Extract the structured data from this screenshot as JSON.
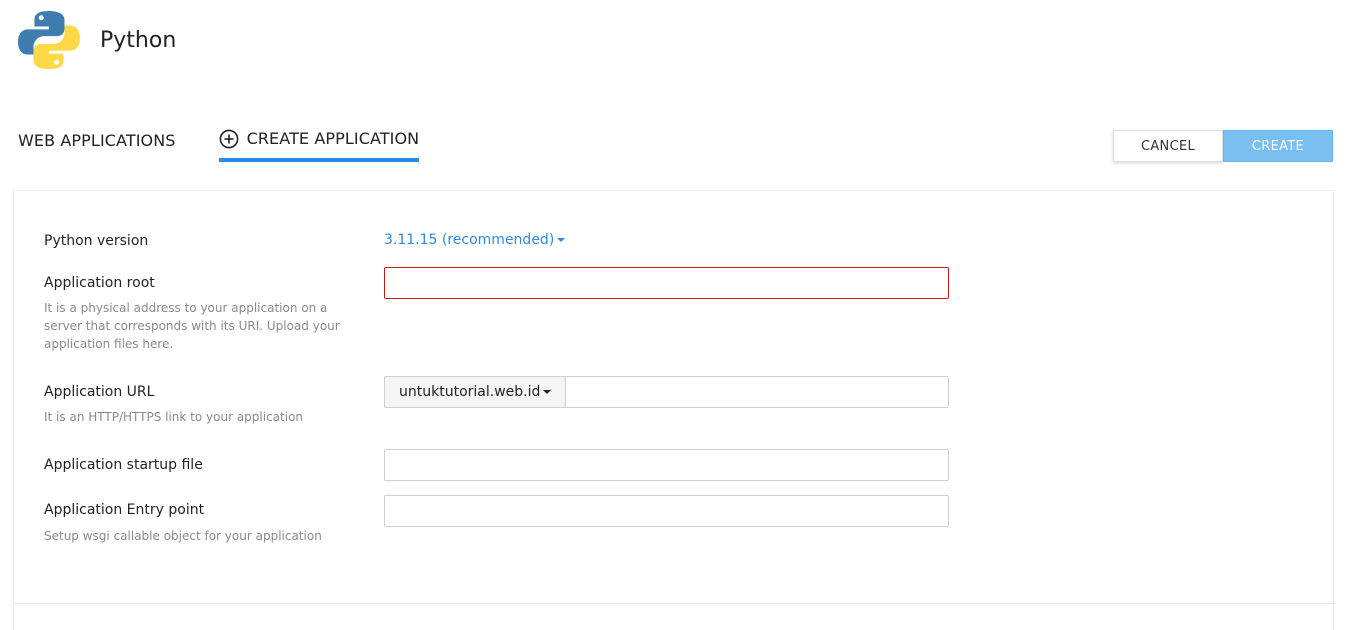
{
  "header": {
    "title": "Python",
    "logo_icon": "python-logo-icon",
    "logo_colors": {
      "blue": "#3f7cb0",
      "yellow": "#fdd847"
    }
  },
  "tabs": [
    {
      "label": "WEB APPLICATIONS",
      "active": false
    },
    {
      "label": "CREATE APPLICATION",
      "active": true,
      "icon": "plus-circle-icon"
    }
  ],
  "actions": {
    "cancel_label": "CANCEL",
    "create_label": "CREATE"
  },
  "form": {
    "python_version": {
      "label": "Python version",
      "value": "3.11.15 (recommended)"
    },
    "app_root": {
      "label": "Application root",
      "hint": "It is a physical address to your application on a server that corresponds with its URI. Upload your application files here.",
      "value": ""
    },
    "app_url": {
      "label": "Application URL",
      "hint": "It is an HTTP/HTTPS link to your application",
      "domain": "untuktutorial.web.id",
      "value": ""
    },
    "startup_file": {
      "label": "Application startup file",
      "value": ""
    },
    "entry_point": {
      "label": "Application Entry point",
      "hint": "Setup wsgi callable object for your application",
      "value": ""
    }
  },
  "colors": {
    "accent": "#2e8bd8",
    "create_button": "#79bff0",
    "error_border": "#c9181c",
    "hint_text": "#8a8a8a"
  }
}
